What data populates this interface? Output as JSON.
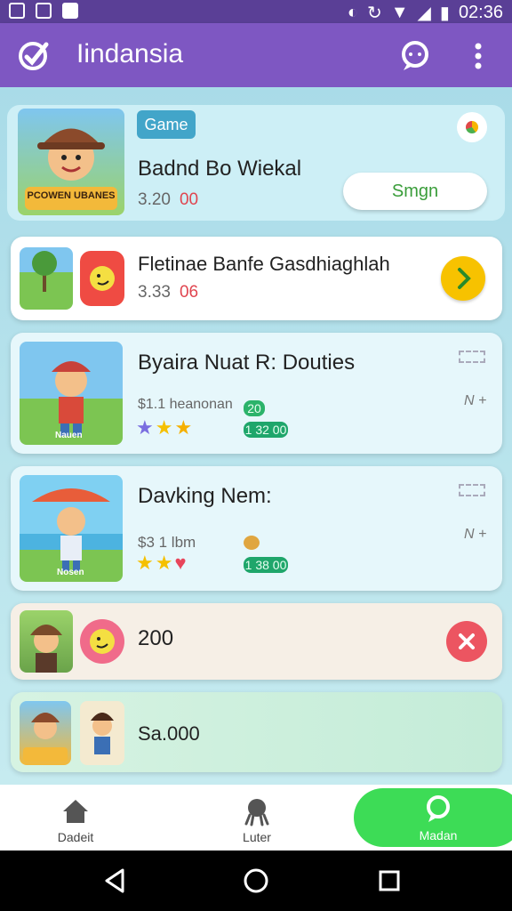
{
  "status_bar": {
    "time": "02:36"
  },
  "app_bar": {
    "title": "Iindansia",
    "logo_icon": "edit-logo-icon",
    "chat_icon": "chat-icon",
    "more_icon": "more-vert-icon"
  },
  "cards": [
    {
      "tag": "Game",
      "title": "Badnd Bo Wiekal",
      "price": "3.20",
      "price_alt": "00",
      "action_label": "Smgn"
    },
    {
      "title": "Fletinae Banfe Gasdhiaghlah",
      "price": "3.33",
      "price_alt": "06"
    },
    {
      "title": "Byaira Nuat R: Douties",
      "price": "$1.1 heanonan",
      "badge_top": "20",
      "badge": "1 32 00",
      "side": "N +"
    },
    {
      "title": "Davking Nem:",
      "price": "$3 1 lbm",
      "badge": "1 38 00",
      "side": "N +"
    },
    {
      "title": "200"
    },
    {
      "title": "Sa.000"
    }
  ],
  "thumb_captions": {
    "card1": "PCOWEN UBANES",
    "card3": "Nauen",
    "card4": "Nosen"
  },
  "bottom_nav": [
    {
      "label": "Dadeit",
      "icon": "home-icon"
    },
    {
      "label": "Luter",
      "icon": "octopus-icon"
    },
    {
      "label": "Madan",
      "icon": "chat-icon"
    }
  ],
  "colors": {
    "status": "#5a3f96",
    "appbar": "#7e57c2",
    "accent_green": "#3ddc56",
    "yellow": "#f7c200",
    "red_close": "#ec5561"
  }
}
